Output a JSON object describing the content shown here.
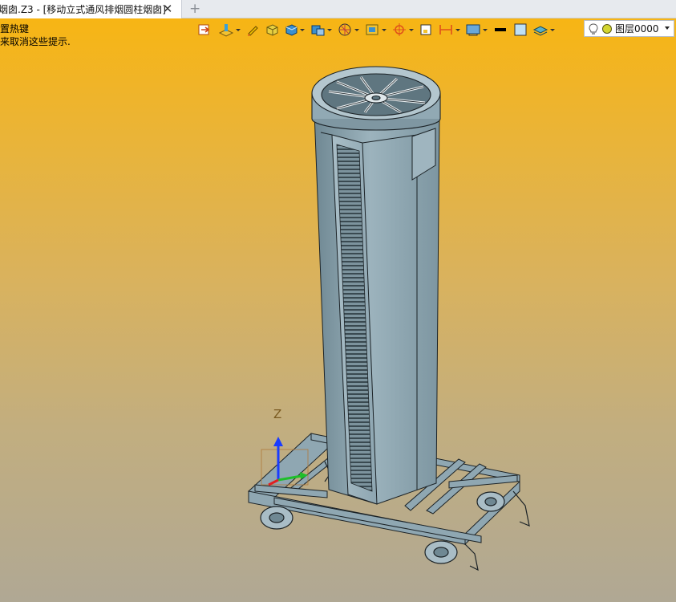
{
  "tab": {
    "title": "烟囱.Z3 - [移动立式通风排烟圆柱烟囱]",
    "close_glyph": "✕",
    "add_glyph": "+"
  },
  "viewport": {
    "hints": [
      "置热键",
      "来取消这些提示."
    ],
    "background_top": "#f7b514",
    "background_bottom": "#b0a894"
  },
  "toolbar": {
    "icons": [
      "exit-sketch-icon",
      "sketch-plane-icon",
      "pencil-icon",
      "solid-shading-icon",
      "box-view-icon",
      "view-cube-icon",
      "render-mode-icon",
      "frame-view-icon",
      "snap-target-icon",
      "constraint-icon",
      "dimension-icon",
      "display-filter-icon",
      "line-color-icon",
      "fill-color-icon",
      "layer-visibility-icon"
    ],
    "layer": {
      "name": "图层0000"
    }
  },
  "triad": {
    "z_label": "Z"
  },
  "colors": {
    "model_fill": "#8fa7b2",
    "model_dark": "#5f7680",
    "model_edge": "#1b2226",
    "axis_z": "#1a3cff",
    "axis_y": "#1fbf2a",
    "axis_x": "#e02020"
  }
}
